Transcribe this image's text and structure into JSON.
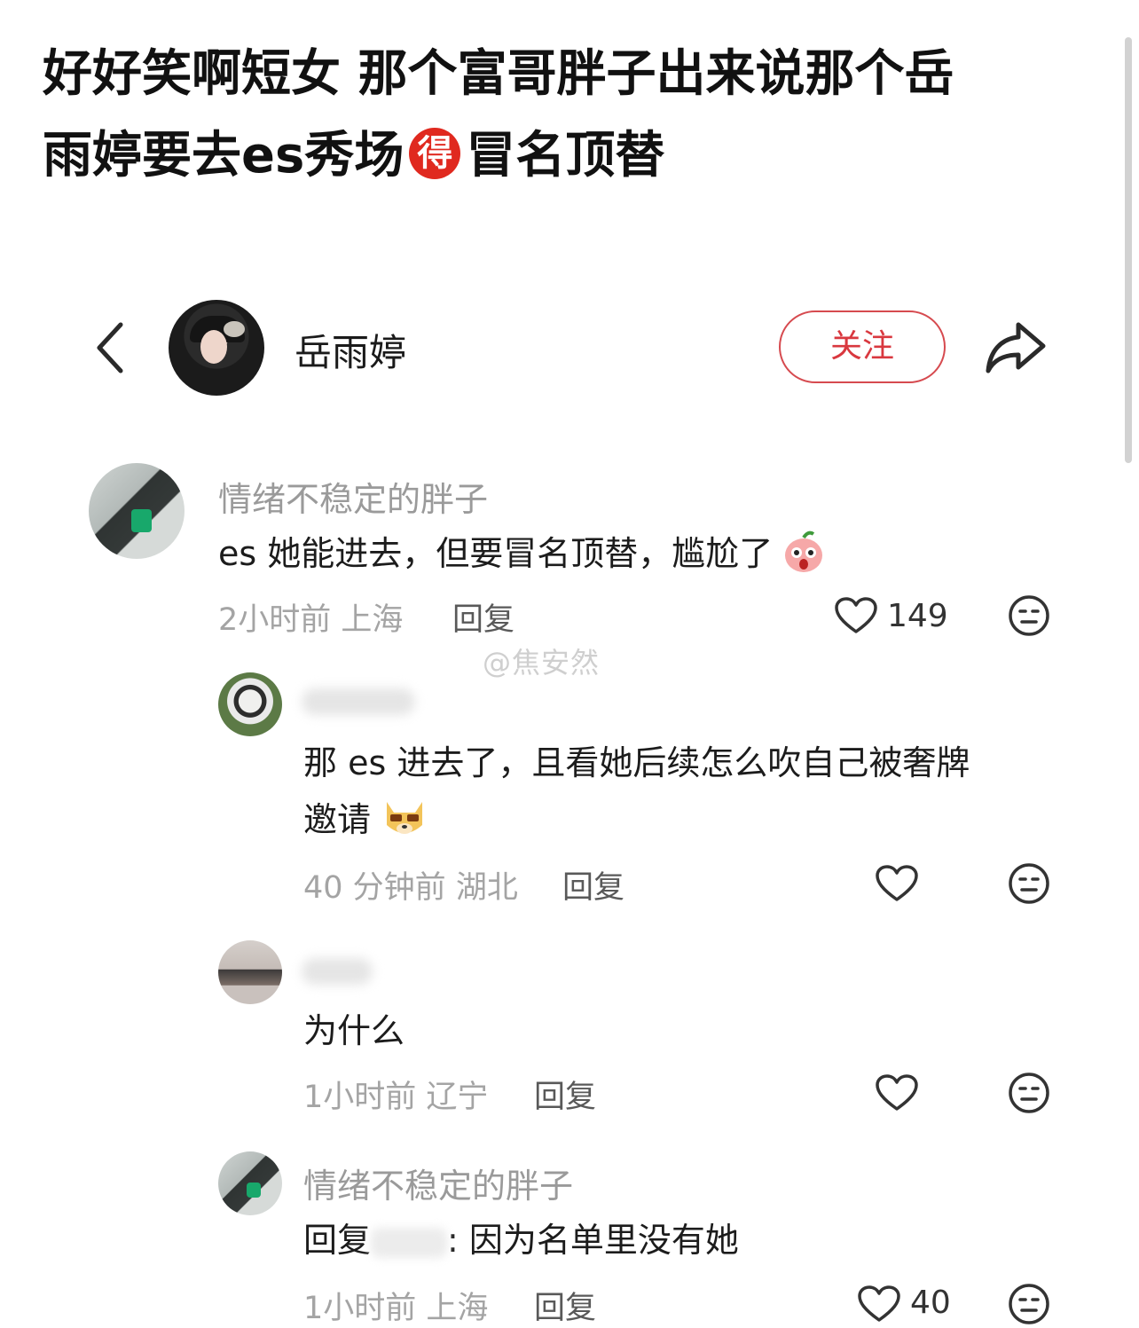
{
  "caption": {
    "line1": "好好笑啊短女 那个富哥胖子出来说那个岳",
    "line2_prefix": "雨婷要去es秀场",
    "badge": "得",
    "line2_suffix": "冒名顶替"
  },
  "header": {
    "username": "岳雨婷",
    "follow_label": "关注",
    "icons": {
      "back": "chevron-left-icon",
      "share": "share-arrow-icon"
    }
  },
  "watermark": "@焦安然",
  "comments": [
    {
      "name": "情绪不稳定的胖子",
      "text": "es 她能进去，但要冒名顶替，尴尬了",
      "time": "2小时前",
      "location": "上海",
      "reply_label": "回复",
      "likes": "149"
    },
    {
      "name": "",
      "text_line1": "那 es 进去了，且看她后续怎么吹自己被奢牌",
      "text_line2": "邀请",
      "time": "40 分钟前",
      "location": "湖北",
      "reply_label": "回复",
      "likes": ""
    },
    {
      "name": "",
      "text": "为什么",
      "time": "1小时前",
      "location": "辽宁",
      "reply_label": "回复",
      "likes": ""
    },
    {
      "name": "情绪不稳定的胖子",
      "reply_prefix": "回复",
      "text": ": 因为名单里没有她",
      "time": "1小时前",
      "location": "上海",
      "reply_label": "回复",
      "likes": "40"
    }
  ]
}
